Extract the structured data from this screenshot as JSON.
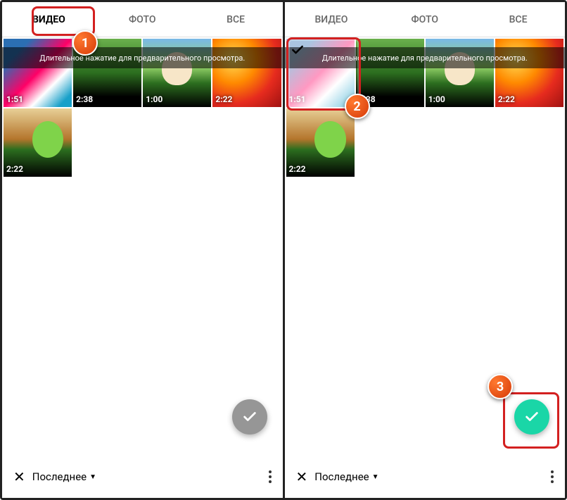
{
  "tabs": {
    "video": "ВИДЕО",
    "photo": "ФОТО",
    "all": "ВСЕ"
  },
  "banner": "Длительное нажатие для предварительного просмотра.",
  "footer": {
    "sort": "Последнее"
  },
  "markers": {
    "one": "1",
    "two": "2",
    "three": "3"
  },
  "left": {
    "thumbs": [
      {
        "dur": "1:51"
      },
      {
        "dur": "2:38"
      },
      {
        "dur": "1:00"
      },
      {
        "dur": "2:22"
      },
      {
        "dur": "2:22"
      }
    ]
  },
  "right": {
    "thumbs": [
      {
        "dur": "1:51"
      },
      {
        "dur": "2:38"
      },
      {
        "dur": "1:00"
      },
      {
        "dur": "2:22"
      },
      {
        "dur": "2:22"
      }
    ]
  }
}
